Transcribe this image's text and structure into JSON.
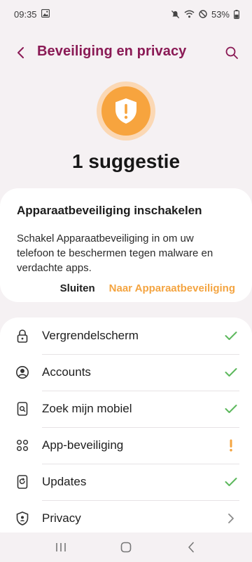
{
  "status_bar": {
    "time": "09:35",
    "battery": "53%"
  },
  "app_bar": {
    "title": "Beveiliging en privacy"
  },
  "hero": {
    "title": "1 suggestie",
    "status_color": "#f7a43e"
  },
  "suggestion": {
    "heading": "Apparaatbeveiliging inschakelen",
    "body": "Schakel Apparaatbeveiliging in om uw telefoon te beschermen tegen malware en verdachte apps.",
    "close_label": "Sluiten",
    "go_label": "Naar Apparaatbeveiliging"
  },
  "list": {
    "items": [
      {
        "label": "Vergrendelscherm",
        "icon": "lock-icon",
        "status": "check"
      },
      {
        "label": "Accounts",
        "icon": "account-icon",
        "status": "check"
      },
      {
        "label": "Zoek mijn mobiel",
        "icon": "find-device-icon",
        "status": "check"
      },
      {
        "label": "App-beveiliging",
        "icon": "apps-icon",
        "status": "warning"
      },
      {
        "label": "Updates",
        "icon": "update-icon",
        "status": "check"
      },
      {
        "label": "Privacy",
        "icon": "privacy-shield-icon",
        "status": "chevron"
      }
    ]
  },
  "colors": {
    "accent_title": "#8a1a55",
    "check": "#5cb85c",
    "warning": "#f4a440"
  }
}
